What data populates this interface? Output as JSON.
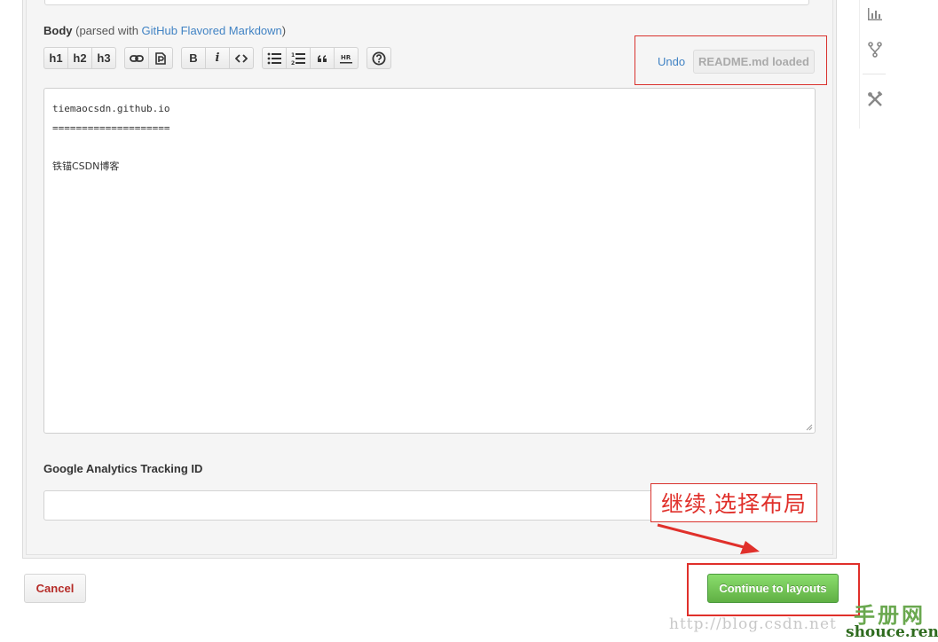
{
  "body_section": {
    "label": "Body",
    "parsed_prefix": "(parsed with ",
    "parsed_link": "GitHub Flavored Markdown",
    "parsed_suffix": ")"
  },
  "toolbar": {
    "h1": "h1",
    "h2": "h2",
    "h3": "h3",
    "bold": "B",
    "italic": "i"
  },
  "undo": {
    "link": "Undo",
    "loaded_button": "README.md loaded"
  },
  "editor": {
    "lines": [
      "tiemaocsdn.github.io",
      "====================",
      "",
      "铁锚CSDN博客"
    ]
  },
  "analytics": {
    "label": "Google Analytics Tracking ID",
    "value": ""
  },
  "annotation": {
    "text": "继续,选择布局"
  },
  "actions": {
    "cancel": "Cancel",
    "continue": "Continue to layouts"
  },
  "watermark": {
    "url": "http://blog.csdn.net",
    "brand_cn": "手册网",
    "brand_en": "shouce.ren"
  },
  "colors": {
    "link": "#4183c4",
    "annotation_red": "#e0302b",
    "continue_green": "#60b044",
    "cancel_red": "#b52b27"
  }
}
